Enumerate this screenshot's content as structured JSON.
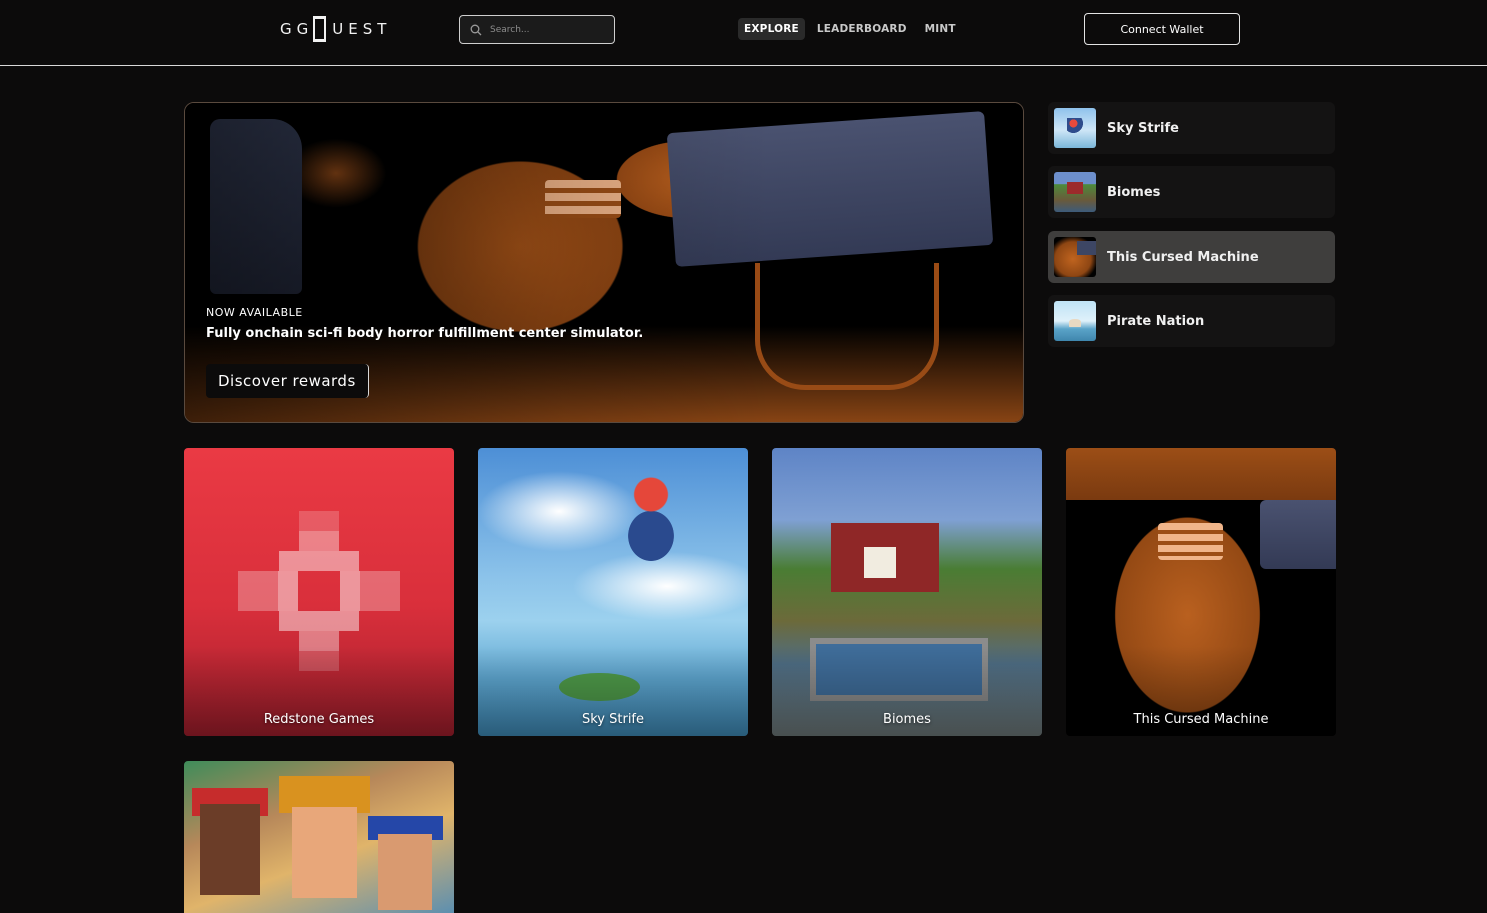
{
  "header": {
    "logo_text": "GG",
    "logo_text_2": "UEST",
    "search_placeholder": "Search...",
    "nav": [
      {
        "label": "EXPLORE",
        "active": true
      },
      {
        "label": "LEADERBOARD",
        "active": false
      },
      {
        "label": "MINT",
        "active": false
      }
    ],
    "connect_label": "Connect Wallet"
  },
  "hero": {
    "kicker": "NOW AVAILABLE",
    "title": "Fully onchain sci-fi body horror fulfillment center simulator.",
    "cta_label": "Discover rewards"
  },
  "sidebar": {
    "items": [
      {
        "label": "Sky Strife",
        "thumb": "sky-strife-thumbnail",
        "active": false
      },
      {
        "label": "Biomes",
        "thumb": "biomes-thumbnail",
        "active": false
      },
      {
        "label": "This Cursed Machine",
        "thumb": "this-cursed-machine-thumbnail",
        "active": true
      },
      {
        "label": "Pirate Nation",
        "thumb": "pirate-nation-thumbnail",
        "active": false
      }
    ]
  },
  "cards": [
    {
      "label": "Redstone Games"
    },
    {
      "label": "Sky Strife"
    },
    {
      "label": "Biomes"
    },
    {
      "label": "This Cursed Machine"
    },
    {
      "label": ""
    }
  ],
  "colors": {
    "background": "#0c0b0b",
    "active_item": "#3f3e3d",
    "redstone": "#e33a44",
    "machine_orange": "#a85418",
    "machine_blue": "#4a5270"
  }
}
